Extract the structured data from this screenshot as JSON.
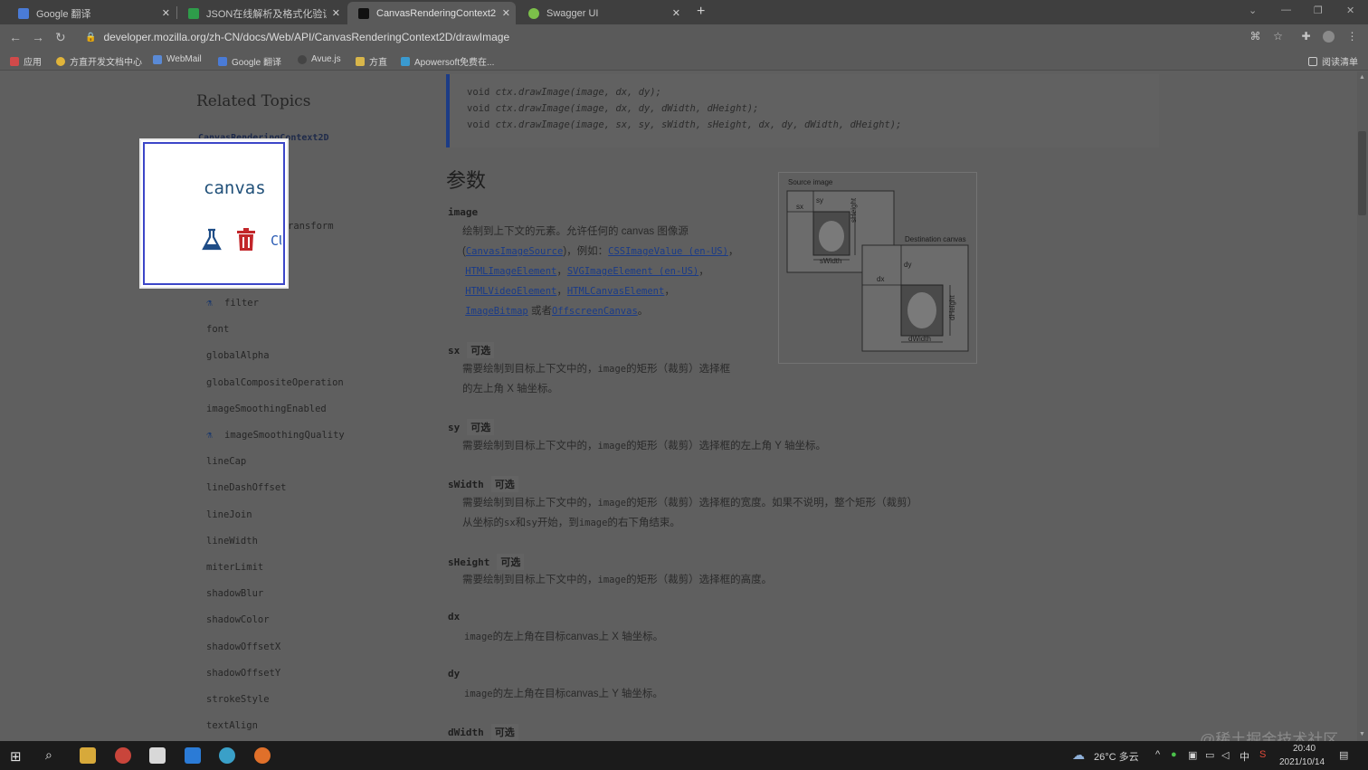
{
  "browser": {
    "tabs": [
      {
        "title": "Google 翻译",
        "active": false,
        "favicon_color": "#4a7bd6"
      },
      {
        "title": "JSON在线解析及格式化验证 - J",
        "active": false,
        "favicon_color": "#2e9c4a"
      },
      {
        "title": "CanvasRenderingContext2D.d",
        "active": true,
        "favicon_color": "#111111"
      },
      {
        "title": "Swagger UI",
        "active": false,
        "favicon_color": "#7cc04a"
      }
    ],
    "new_tab_icon": "plus-icon",
    "url": "developer.mozilla.org/zh-CN/docs/Web/API/CanvasRenderingContext2D/drawImage",
    "bookmarks": [
      {
        "label": "应用",
        "icon": "apps-grid-icon",
        "color": "#d14a4a"
      },
      {
        "label": "方直开发文档中心",
        "icon": "sun-icon",
        "color": "#e0b43a"
      },
      {
        "label": "WebMail",
        "icon": "webmail-icon",
        "color": "#5a8ad6"
      },
      {
        "label": "Google 翻译",
        "icon": "translate-icon",
        "color": "#4a7bd6"
      },
      {
        "label": "Avue.js",
        "icon": "avue-icon",
        "color": "#444444"
      },
      {
        "label": "方直",
        "icon": "folder-icon",
        "color": "#d8b64a"
      },
      {
        "label": "Apowersoft免费在...",
        "icon": "apowersoft-icon",
        "color": "#3a9ad0"
      }
    ],
    "reading_list": "阅读清单"
  },
  "sidebar": {
    "title": "Related Topics",
    "context": "CanvasRenderingContext2D",
    "partial_item": "ransform",
    "items": [
      {
        "label": "filter",
        "experimental": true
      },
      {
        "label": "font",
        "experimental": false
      },
      {
        "label": "globalAlpha",
        "experimental": false
      },
      {
        "label": "globalCompositeOperation",
        "experimental": false
      },
      {
        "label": "imageSmoothingEnabled",
        "experimental": false
      },
      {
        "label": "imageSmoothingQuality",
        "experimental": true
      },
      {
        "label": "lineCap",
        "experimental": false
      },
      {
        "label": "lineDashOffset",
        "experimental": false
      },
      {
        "label": "lineJoin",
        "experimental": false
      },
      {
        "label": "lineWidth",
        "experimental": false
      },
      {
        "label": "miterLimit",
        "experimental": false
      },
      {
        "label": "shadowBlur",
        "experimental": false
      },
      {
        "label": "shadowColor",
        "experimental": false
      },
      {
        "label": "shadowOffsetX",
        "experimental": false
      },
      {
        "label": "shadowOffsetY",
        "experimental": false
      },
      {
        "label": "strokeStyle",
        "experimental": false
      },
      {
        "label": "textAlign",
        "experimental": false
      }
    ]
  },
  "popup": {
    "text": "canvas",
    "partial": "CU"
  },
  "code": {
    "prefix": "void ",
    "fn": "ctx.drawImage(",
    "lines": [
      "image, dx, dy);",
      "image, dx, dy, dWidth, dHeight);",
      "image, sx, sy, sWidth, sHeight, dx, dy, dWidth, dHeight);"
    ]
  },
  "params": {
    "heading": "参数",
    "optional": "可选",
    "image": {
      "name": "image",
      "line1": "绘制到上下文的元素。允许任何的 canvas 图像源",
      "l2_a": "(",
      "l2_link1": "CanvasImageSource",
      "l2_b": ")，例如：",
      "l2_link2": "CSSImageValue (en-US)",
      "l2_c": "，",
      "l3_link1": "HTMLImageElement",
      "l3_a": "，",
      "l3_link2": "SVGImageElement (en-US)",
      "l3_b": "，",
      "l4_link1": "HTMLVideoElement",
      "l4_a": "，",
      "l4_link2": "HTMLCanvasElement",
      "l4_b": "，",
      "l5_link1": "ImageBitmap",
      "l5_a": " 或者",
      "l5_link2": "OffscreenCanvas",
      "l5_b": "。"
    },
    "sx": {
      "name": "sx",
      "l1a": "需要绘制到目标上下文中的，",
      "l1code": "image",
      "l1b": "的矩形（裁剪）选择框",
      "l2": "的左上角 X 轴坐标。"
    },
    "sy": {
      "name": "sy",
      "l1a": "需要绘制到目标上下文中的，",
      "l1code": "image",
      "l1b": "的矩形（裁剪）选择框的左上角 Y 轴坐标。"
    },
    "sWidth": {
      "name": "sWidth",
      "l1a": "需要绘制到目标上下文中的，",
      "l1code": "image",
      "l1b": "的矩形（裁剪）选择框的宽度。如果不说明，整个矩形（裁剪）",
      "l2a": "从坐标的",
      "l2c1": "sx",
      "l2b": "和",
      "l2c2": "sy",
      "l2c": "开始，到",
      "l2c3": "image",
      "l2d": "的右下角结束。"
    },
    "sHeight": {
      "name": "sHeight",
      "l1a": "需要绘制到目标上下文中的，",
      "l1code": "image",
      "l1b": "的矩形（裁剪）选择框的高度。"
    },
    "dx": {
      "name": "dx",
      "code": "image",
      "text": "的左上角在目标canvas上 X 轴坐标。"
    },
    "dy": {
      "name": "dy",
      "code": "image",
      "text": "的左上角在目标canvas上 Y 轴坐标。"
    },
    "dWidth": {
      "name": "dWidth"
    }
  },
  "diagram": {
    "source_label": "Source image",
    "dest_label": "Destination canvas",
    "labels": [
      "sx",
      "sy",
      "sHeight",
      "sWidth",
      "dx",
      "dy",
      "dHeight",
      "dWidth"
    ]
  },
  "taskbar": {
    "weather": "26°C 多云",
    "ime": "中",
    "time": "20:40",
    "date": "2021/10/14"
  },
  "watermark": "@稀土掘金技术社区"
}
